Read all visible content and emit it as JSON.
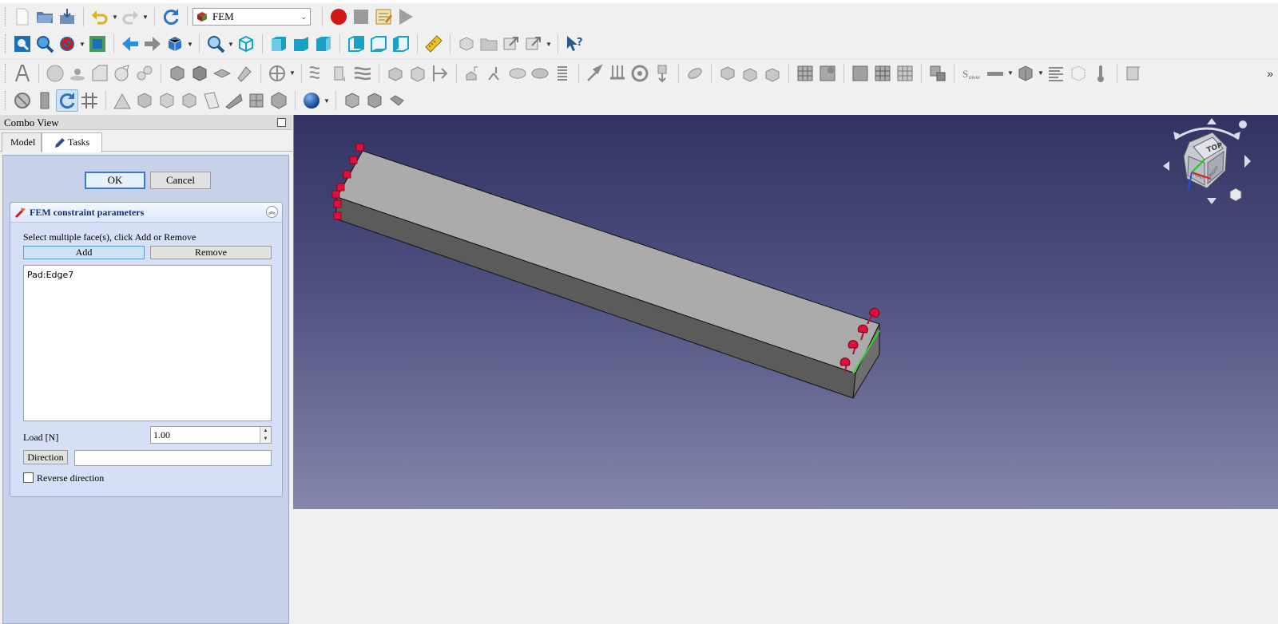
{
  "toolbar": {
    "workbench": {
      "label": "FEM"
    },
    "overflow": "»"
  },
  "combo_view": {
    "title": "Combo View",
    "tabs": [
      {
        "label": "Model"
      },
      {
        "label": "Tasks"
      }
    ]
  },
  "task": {
    "ok_label": "OK",
    "cancel_label": "Cancel",
    "panel_title": "FEM constraint parameters",
    "hint": "Select multiple face(s), click Add or Remove",
    "add_label": "Add",
    "remove_label": "Remove",
    "references": [
      "Pad:Edge7"
    ],
    "load_label": "Load [N]",
    "load_value": "1.00",
    "direction_label": "Direction",
    "direction_value": "",
    "reverse_label": "Reverse direction",
    "reverse_checked": false
  },
  "navcube": {
    "face_top": "TOP",
    "face_front": "FRONT",
    "face_right": "RIGHT"
  },
  "colors": {
    "view_bg_top": "#313363",
    "view_bg_bottom": "#8486ac",
    "constraint_marker": "#e0103c",
    "task_panel_bg": "#c7d1ea"
  }
}
